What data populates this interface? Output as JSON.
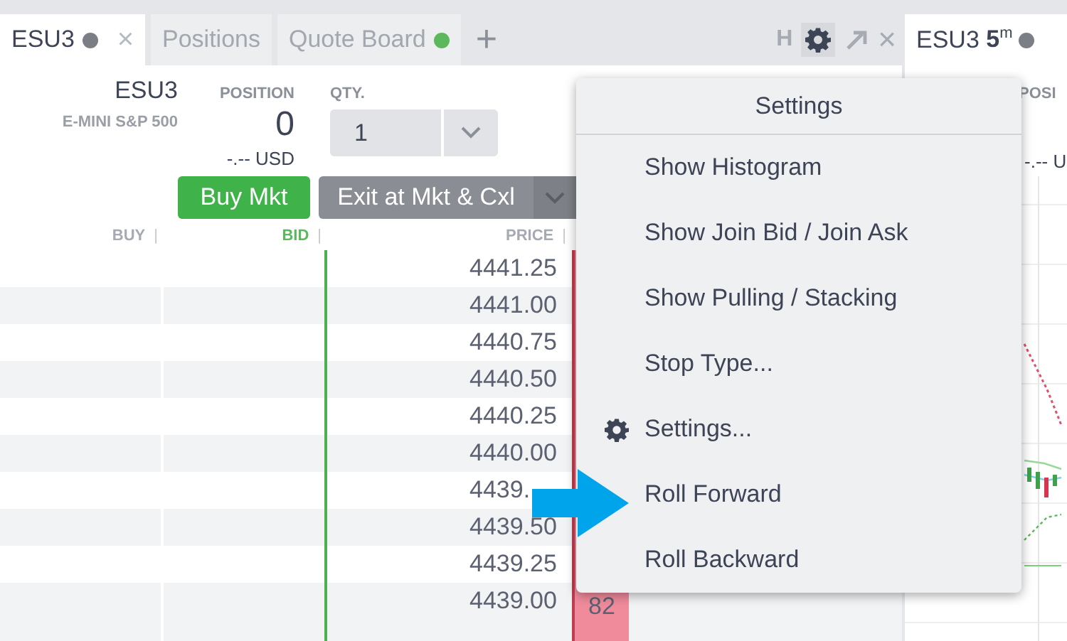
{
  "tabs": [
    {
      "label": "ESU3",
      "selected": true,
      "color": "#7b7e84",
      "closable": true
    },
    {
      "label": "Positions",
      "selected": false,
      "closable": false
    },
    {
      "label": "Quote Board",
      "selected": false,
      "color": "#5cb85c",
      "closable": false
    }
  ],
  "toolbar": {
    "add": "+",
    "histogram": "H",
    "close": "×"
  },
  "instrument": {
    "symbol": "ESU3",
    "name": "E-MINI S&P 500"
  },
  "position": {
    "label": "POSITION",
    "value": "0",
    "pnl": "-.-- USD"
  },
  "qty": {
    "label": "QTY.",
    "value": "1"
  },
  "buttons": {
    "buy": "Buy Mkt",
    "exit": "Exit at Mkt & Cxl"
  },
  "columns": [
    {
      "label": "BUY",
      "kind": "plain",
      "divider": "|"
    },
    {
      "label": "BID",
      "kind": "bid",
      "divider": "|"
    },
    {
      "label": "PRICE",
      "kind": "plain",
      "divider": "|"
    }
  ],
  "rows": [
    {
      "price": "4441.25"
    },
    {
      "price": "4441.00"
    },
    {
      "price": "4440.75"
    },
    {
      "price": "4440.50"
    },
    {
      "price": "4440.25"
    },
    {
      "price": "4440.00"
    },
    {
      "price": "4439."
    },
    {
      "price": "4439.50"
    },
    {
      "price": "4439.25"
    },
    {
      "price": "4439.00",
      "ask": "82"
    }
  ],
  "menu": {
    "title": "Settings",
    "items": [
      {
        "label": "Show Histogram",
        "kind": "plain"
      },
      {
        "label": "Show Join Bid / Join Ask",
        "kind": "plain"
      },
      {
        "label": "Show Pulling / Stacking",
        "kind": "plain"
      },
      {
        "label": "Stop Type...",
        "kind": "plain"
      },
      {
        "label": "Settings...",
        "kind": "gear"
      },
      {
        "label": "Roll Forward",
        "kind": "plain"
      },
      {
        "label": "Roll Backward",
        "kind": "plain"
      }
    ]
  },
  "right_panel": {
    "tab": {
      "symbol": "ESU3",
      "interval": "5",
      "unit": "m"
    },
    "position_label": "POSI",
    "pnl": "-.-- U"
  }
}
